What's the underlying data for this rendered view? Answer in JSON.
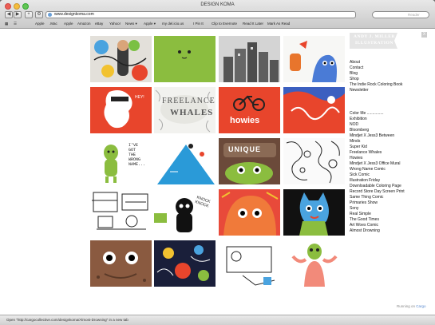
{
  "window": {
    "title": "DESIGN KOMA"
  },
  "toolbar": {
    "url": "www.designkoma.com",
    "search_placeholder": "Reader",
    "back_label": "◀",
    "forward_label": "▶",
    "add_label": "+"
  },
  "bookmarks": [
    "Apple",
    ".Mac",
    "Apple",
    "Amazon",
    "eBay",
    "Yahoo!",
    "News ▾",
    "Apple ▾",
    "my del.icio.us",
    "I Pin It",
    "Clip to Evernote",
    "Read It Later",
    "Mark As Read"
  ],
  "bookmarks_icon": "grid-icon",
  "site": {
    "logo_line1": "ANDY J. MILLER",
    "logo_line2": "ILLUSTRATION",
    "close_label": "X",
    "menu_top": [
      "About",
      "Contact",
      "Blog",
      "Shop",
      "The Indie Rock Coloring Book",
      "Newsletter"
    ],
    "menu_projects": [
      "Color Me ...............",
      "Exhibition",
      "NOD",
      "Bloomberg",
      "Mindjet X Jess3 Between",
      "Minds",
      "Super Kid",
      "Freelance Whales",
      "Howies",
      "Mindjet X Jess3 Office Mural",
      "Wrong Name Comic",
      "Sick Comic",
      "Illustration Friday",
      "Downloadable Coloring Page",
      "Record Store Day Screen Print",
      "Same Thing Comic",
      "Primaries Show",
      "Sony",
      "Real Simple",
      "The Good Times",
      "Art Woes Comic",
      "Almost Drowning"
    ],
    "running_on_prefix": "Running on",
    "running_on_link": "Cargo",
    "tile_texts": {
      "freelance": "FREELANCE",
      "whales": "WHALES",
      "howies": "howies",
      "unique": "UNIQUE",
      "wrong1": "I'VE",
      "wrong2": "GOT",
      "wrong3": "THE",
      "wrong4": "WRONG",
      "wrong5": "NAME...",
      "knock": "KNOCK",
      "knock2": "KNOCK"
    }
  },
  "status": {
    "text": "Open \"http://cargocollective.com/designkoma/Almost-Drowning\" in a new tab"
  },
  "colors": {
    "accent_red": "#e8452c",
    "accent_green": "#8bbd3f",
    "accent_blue": "#2a9ad8",
    "cargo_link": "#5a8bd0"
  }
}
